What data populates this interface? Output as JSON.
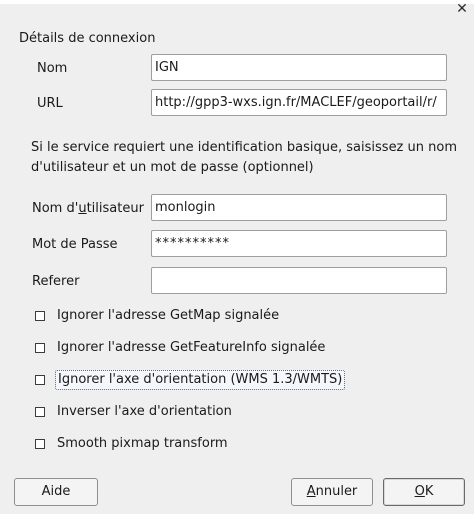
{
  "window": {
    "close_glyph": "✕"
  },
  "section": {
    "title": "Détails de connexion"
  },
  "fields": {
    "nom": {
      "label": "Nom",
      "value": "IGN"
    },
    "url": {
      "label": "URL",
      "value": "http://gpp3-wxs.ign.fr/MACLEF/geoportail/r/"
    },
    "username": {
      "label_pre": "Nom d'",
      "label_u": "u",
      "label_post": "tilisateur",
      "value": "monlogin"
    },
    "password": {
      "label": "Mot de Passe",
      "value": "**********"
    },
    "referer": {
      "label": "Referer",
      "value": ""
    }
  },
  "info_text": "Si le service requiert une identification basique, saisissez un nom d'utilisateur et un mot de passe (optionnel)",
  "checkboxes": [
    {
      "label": "Ignorer l'adresse GetMap signalée",
      "checked": false
    },
    {
      "label": "Ignorer l'adresse GetFeatureInfo signalée",
      "checked": false
    },
    {
      "label": "Ignorer l'axe d'orientation (WMS 1.3/WMTS)",
      "checked": false
    },
    {
      "label": "Inverser l'axe d'orientation",
      "checked": false
    },
    {
      "label": "Smooth pixmap transform",
      "checked": false
    }
  ],
  "buttons": {
    "help": "Aide",
    "cancel_u": "A",
    "cancel_rest": "nnuler",
    "ok_u": "O",
    "ok_rest": "K"
  }
}
